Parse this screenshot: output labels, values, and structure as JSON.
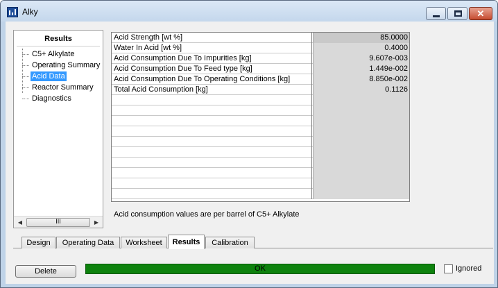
{
  "window": {
    "title": "Alky"
  },
  "results": {
    "heading": "Results",
    "tree": [
      {
        "label": "C5+ Alkylate",
        "selected": false
      },
      {
        "label": "Operating Summary",
        "selected": false
      },
      {
        "label": "Acid Data",
        "selected": true
      },
      {
        "label": "Reactor Summary",
        "selected": false
      },
      {
        "label": "Diagnostics",
        "selected": false
      }
    ],
    "scroll_thumb": "III"
  },
  "table": {
    "rows": [
      {
        "name": "Acid Strength [wt %]",
        "value": "85.0000"
      },
      {
        "name": "Water In Acid [wt %]",
        "value": "0.4000"
      },
      {
        "name": "Acid Consumption Due To Impurities [kg]",
        "value": "9.607e-003"
      },
      {
        "name": "Acid Consumption Due To Feed type [kg]",
        "value": "1.449e-002"
      },
      {
        "name": "Acid Consumption Due To Operating Conditions [kg]",
        "value": "8.850e-002"
      },
      {
        "name": "Total Acid Consumption [kg]",
        "value": "0.1126"
      }
    ],
    "note": "Acid consumption values are per barrel of C5+ Alkylate"
  },
  "tabs": [
    {
      "label": "Design",
      "active": false
    },
    {
      "label": "Operating Data",
      "active": false
    },
    {
      "label": "Worksheet",
      "active": false
    },
    {
      "label": "Results",
      "active": true
    },
    {
      "label": "Calibration",
      "active": false
    }
  ],
  "footer": {
    "delete_label": "Delete",
    "status_text": "OK",
    "status_color": "#0d820d",
    "ignored_label": "Ignored",
    "ignored_checked": false
  }
}
